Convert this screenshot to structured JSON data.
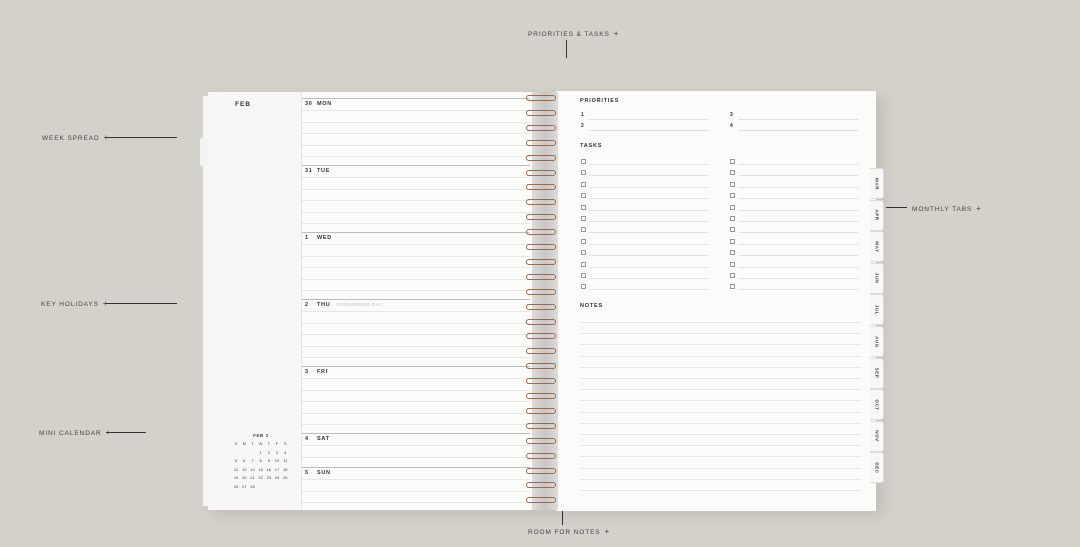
{
  "callouts": {
    "top": "PRIORITIES & TASKS",
    "week": "WEEK SPREAD",
    "holidays": "KEY HOLIDAYS",
    "mini": "MINI CALENDAR",
    "notes": "ROOM FOR NOTES",
    "tabs": "MONTHLY TABS",
    "plus": "+"
  },
  "left_page": {
    "month": "FEB",
    "days": [
      {
        "num": "30",
        "name": "MON",
        "holiday": ""
      },
      {
        "num": "31",
        "name": "TUE",
        "holiday": ""
      },
      {
        "num": "1",
        "name": "WED",
        "holiday": ""
      },
      {
        "num": "2",
        "name": "THU",
        "holiday": "GROUNDHOG DAY"
      },
      {
        "num": "3",
        "name": "FRI",
        "holiday": ""
      },
      {
        "num": "4",
        "name": "SAT",
        "holiday": ""
      },
      {
        "num": "5",
        "name": "SUN",
        "holiday": ""
      }
    ],
    "mini_calendar": {
      "title": "FEB 2",
      "headers": [
        "S",
        "M",
        "T",
        "W",
        "T",
        "F",
        "S"
      ],
      "cells": [
        "",
        "",
        "",
        "1",
        "2",
        "3",
        "4",
        "5",
        "6",
        "7",
        "8",
        "9",
        "10",
        "11",
        "12",
        "13",
        "14",
        "15",
        "16",
        "17",
        "18",
        "19",
        "20",
        "21",
        "22",
        "23",
        "24",
        "25",
        "26",
        "27",
        "28",
        "",
        "",
        "",
        ""
      ]
    }
  },
  "right_page": {
    "priorities_label": "PRIORITIES",
    "priorities": [
      "1",
      "3",
      "2",
      "4"
    ],
    "tasks_label": "TASKS",
    "notes_label": "NOTES"
  },
  "tabs": [
    "MAR",
    "APR",
    "MAY",
    "JUN",
    "JUL",
    "AUG",
    "SEP",
    "OCT",
    "NOV",
    "DEC"
  ]
}
